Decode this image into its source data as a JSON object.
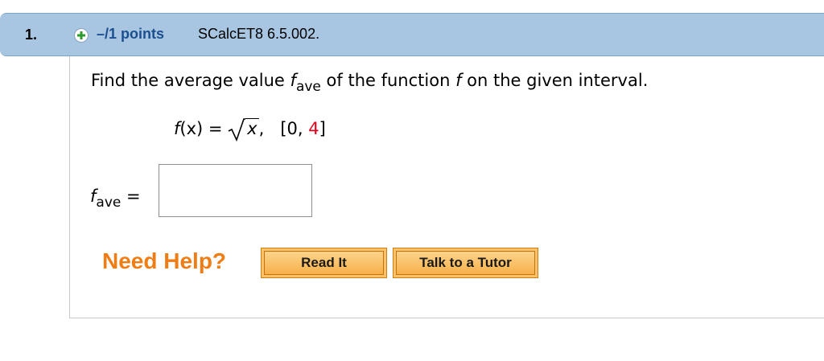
{
  "question": {
    "number": "1.",
    "plus_icon": "plus-circle-icon",
    "points": "–/1 points",
    "code": "SCalcET8 6.5.002."
  },
  "prompt": {
    "part1": "Find the average value ",
    "f": "f",
    "sub": "ave",
    "part2": " of the function ",
    "f2": "f",
    "part3": " on the given interval."
  },
  "equation": {
    "lhs_f": "f",
    "lhs_rest": "(x) = ",
    "radicand": "x",
    "sep": ",",
    "interval_open": "[0, ",
    "interval_upper": "4",
    "interval_close": "]"
  },
  "answer": {
    "label_f": "f",
    "label_sub": "ave",
    "label_eq": " =",
    "value": ""
  },
  "help": {
    "title": "Need Help?",
    "read_it": "Read It",
    "talk_to_tutor": "Talk to a Tutor"
  },
  "colors": {
    "header_bg": "#a8c6e1",
    "points_blue": "#1c4f8f",
    "need_help_orange": "#f07d14",
    "interval_red": "#e0001b"
  }
}
